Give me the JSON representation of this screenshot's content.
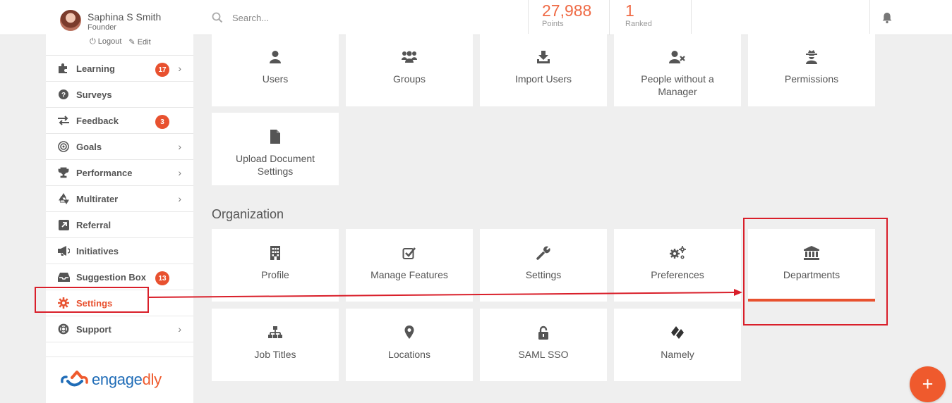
{
  "user": {
    "name": "Saphina S Smith",
    "role": "Founder",
    "logout_label": "Logout",
    "edit_label": "Edit"
  },
  "search": {
    "placeholder": "Search..."
  },
  "stats": [
    {
      "value": "27,988",
      "label": "Points"
    },
    {
      "value": "1",
      "label": "Ranked"
    }
  ],
  "sidebar": {
    "items": [
      {
        "label": "Learning",
        "icon": "puzzle-icon",
        "badge": "17",
        "chevron": true
      },
      {
        "label": "Surveys",
        "icon": "question-icon"
      },
      {
        "label": "Feedback",
        "icon": "exchange-icon",
        "badge": "3"
      },
      {
        "label": "Goals",
        "icon": "target-icon",
        "chevron": true
      },
      {
        "label": "Performance",
        "icon": "trophy-icon",
        "chevron": true
      },
      {
        "label": "Multirater",
        "icon": "recycle-icon",
        "chevron": true
      },
      {
        "label": "Referral",
        "icon": "external-link-icon"
      },
      {
        "label": "Initiatives",
        "icon": "megaphone-icon"
      },
      {
        "label": "Suggestion Box",
        "icon": "inbox-icon",
        "badge": "13"
      },
      {
        "label": "Settings",
        "icon": "gear-icon",
        "active": true
      },
      {
        "label": "Support",
        "icon": "life-ring-icon",
        "chevron": true
      }
    ]
  },
  "logo": {
    "left": "engage",
    "right": "dly"
  },
  "people_tiles": [
    {
      "label": "Users",
      "icon": "user-icon"
    },
    {
      "label": "Groups",
      "icon": "users-icon"
    },
    {
      "label": "Import Users",
      "icon": "download-icon"
    },
    {
      "label": "People without a Manager",
      "icon": "user-remove-icon"
    },
    {
      "label": "Permissions",
      "icon": "user-secret-icon"
    },
    {
      "label": "Upload Document Settings",
      "icon": "document-icon"
    }
  ],
  "organization": {
    "title": "Organization",
    "tiles": [
      {
        "label": "Profile",
        "icon": "building-icon"
      },
      {
        "label": "Manage Features",
        "icon": "checkbox-icon"
      },
      {
        "label": "Settings",
        "icon": "wrench-icon"
      },
      {
        "label": "Preferences",
        "icon": "gears-icon"
      },
      {
        "label": "Departments",
        "icon": "institution-icon"
      },
      {
        "label": "Job Titles",
        "icon": "sitemap-icon"
      },
      {
        "label": "Locations",
        "icon": "map-marker-icon"
      },
      {
        "label": "SAML SSO",
        "icon": "unlock-icon"
      },
      {
        "label": "Namely",
        "icon": "namely-icon"
      }
    ]
  },
  "colors": {
    "accent": "#e8512f",
    "callout": "#d91f2a",
    "text": "#555555"
  },
  "fab_label": "+"
}
